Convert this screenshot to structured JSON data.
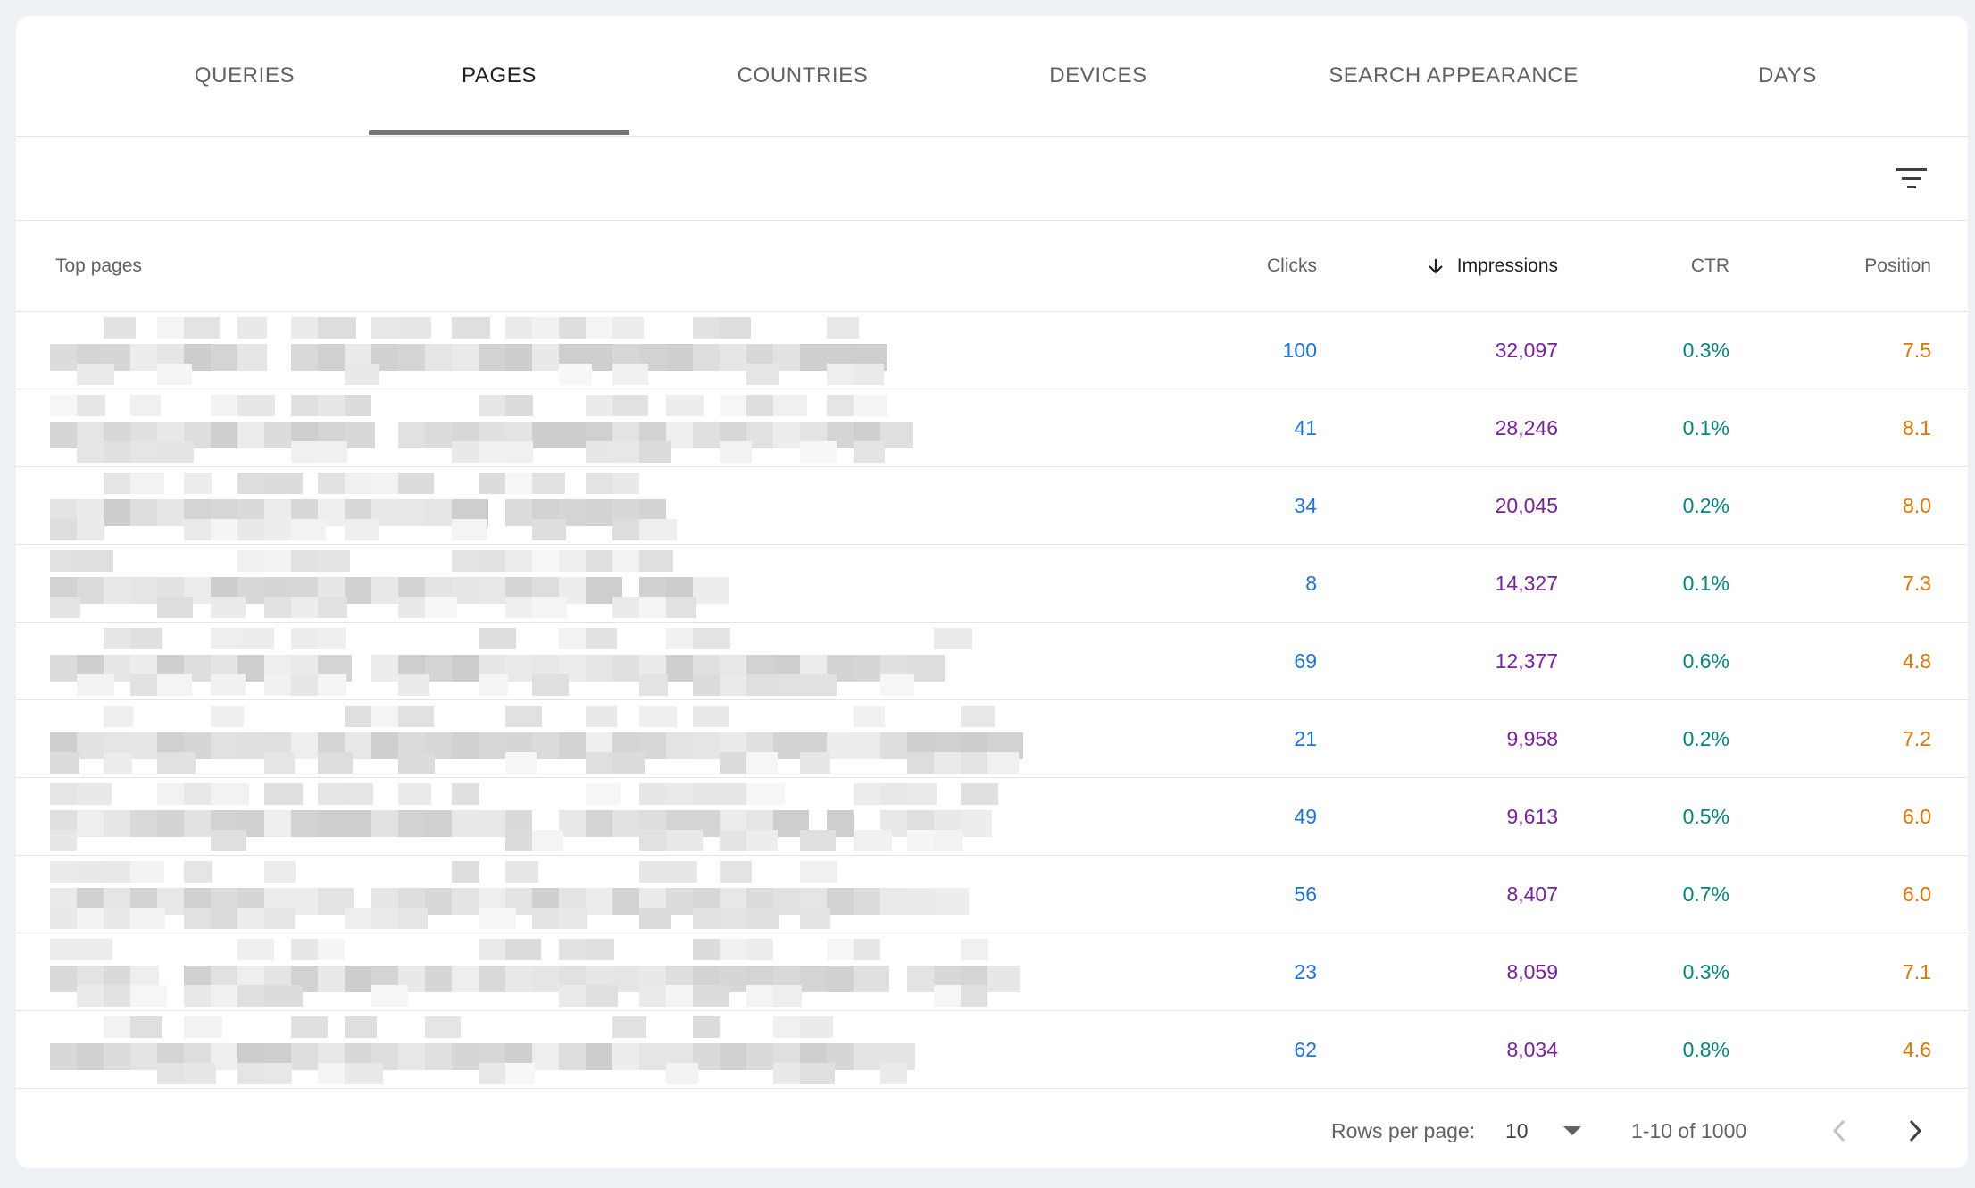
{
  "tabs": [
    {
      "label": "QUERIES",
      "active": false
    },
    {
      "label": "PAGES",
      "active": true
    },
    {
      "label": "COUNTRIES",
      "active": false
    },
    {
      "label": "DEVICES",
      "active": false
    },
    {
      "label": "SEARCH APPEARANCE",
      "active": false
    },
    {
      "label": "DAYS",
      "active": false
    }
  ],
  "toolbar": {
    "filter_icon": "filter-icon"
  },
  "table": {
    "columns": {
      "page": "Top pages",
      "clicks": "Clicks",
      "impressions": "Impressions",
      "ctr": "CTR",
      "position": "Position"
    },
    "sort_icon": "arrow-down-icon",
    "rows": [
      {
        "clicks": "100",
        "impressions": "32,097",
        "ctr": "0.3%",
        "position": "7.5"
      },
      {
        "clicks": "41",
        "impressions": "28,246",
        "ctr": "0.1%",
        "position": "8.1"
      },
      {
        "clicks": "34",
        "impressions": "20,045",
        "ctr": "0.2%",
        "position": "8.0"
      },
      {
        "clicks": "8",
        "impressions": "14,327",
        "ctr": "0.1%",
        "position": "7.3"
      },
      {
        "clicks": "69",
        "impressions": "12,377",
        "ctr": "0.6%",
        "position": "4.8"
      },
      {
        "clicks": "21",
        "impressions": "9,958",
        "ctr": "0.2%",
        "position": "7.2"
      },
      {
        "clicks": "49",
        "impressions": "9,613",
        "ctr": "0.5%",
        "position": "6.0"
      },
      {
        "clicks": "56",
        "impressions": "8,407",
        "ctr": "0.7%",
        "position": "6.0"
      },
      {
        "clicks": "23",
        "impressions": "8,059",
        "ctr": "0.3%",
        "position": "7.1"
      },
      {
        "clicks": "62",
        "impressions": "8,034",
        "ctr": "0.8%",
        "position": "4.6"
      }
    ]
  },
  "footer": {
    "rows_per_page_label": "Rows per page:",
    "rows_per_page_value": "10",
    "range": "1-10 of 1000",
    "prev_icon": "chevron-left-icon",
    "next_icon": "chevron-right-icon"
  },
  "colors": {
    "clicks": "#1a73e8",
    "impressions": "#7b1fa2",
    "ctr": "#00897b",
    "position": "#e37400",
    "active_tab_indicator": "#70757a"
  }
}
